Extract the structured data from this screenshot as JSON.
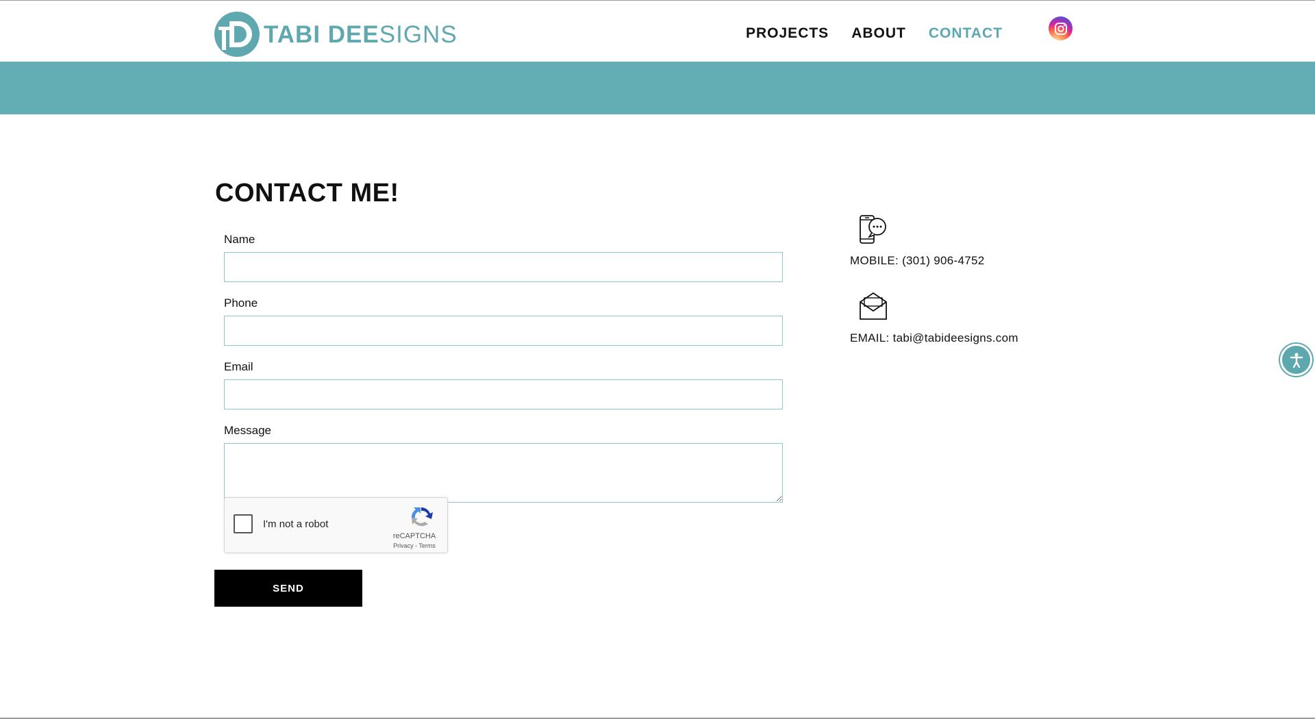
{
  "header": {
    "logo": {
      "initials": "TD",
      "bold": "TABI DEE",
      "light": "SIGNS"
    },
    "nav": [
      {
        "label": "PROJECTS",
        "active": false
      },
      {
        "label": "ABOUT",
        "active": false
      },
      {
        "label": "CONTACT",
        "active": true
      }
    ],
    "social_icon": "instagram-icon"
  },
  "colors": {
    "accent": "#63aeb5",
    "nav_active": "#5aa9b2",
    "button_bg": "#000000"
  },
  "page": {
    "title": "CONTACT ME!"
  },
  "form": {
    "name_label": "Name",
    "name_value": "",
    "phone_label": "Phone",
    "phone_value": "",
    "email_label": "Email",
    "email_value": "",
    "message_label": "Message",
    "message_value": "",
    "captcha": {
      "label": "I'm not a robot",
      "brand": "reCAPTCHA",
      "links": "Privacy - Terms"
    },
    "send_label": "SEND"
  },
  "contact_info": {
    "mobile": {
      "icon": "phone-chat-icon",
      "text": "MOBILE: (301) 906-4752"
    },
    "email": {
      "icon": "envelope-icon",
      "text": "EMAIL: tabi@tabideesigns.com"
    }
  },
  "accessibility_icon": "accessibility-icon"
}
